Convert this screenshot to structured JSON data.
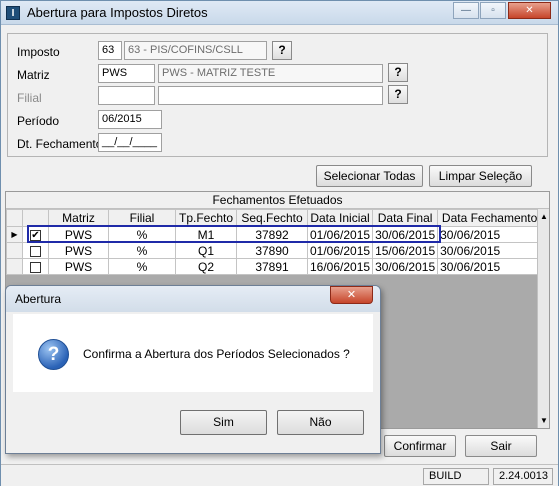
{
  "window": {
    "title": "Abertura para Impostos Diretos",
    "app_icon": "I",
    "minimize_glyph": "—",
    "maximize_glyph": "▫",
    "close_glyph": "✕"
  },
  "form": {
    "imposto_label": "Imposto",
    "imposto_code": "63",
    "imposto_desc": "63 - PIS/COFINS/CSLL",
    "matriz_label": "Matriz",
    "matriz_code": "PWS",
    "matriz_desc": "PWS - MATRIZ TESTE",
    "filial_label": "Filial",
    "filial_code": "",
    "filial_desc": "",
    "periodo_label": "Período",
    "periodo_value": "06/2015",
    "dt_fechamento_label": "Dt. Fechamento",
    "dt_fechamento_value": "__/__/____",
    "lookup_glyph": "?"
  },
  "buttons": {
    "selecionar_todas": "Selecionar Todas",
    "limpar_selecao": "Limpar Seleção",
    "confirmar": "Confirmar",
    "sair": "Sair"
  },
  "grid": {
    "caption": "Fechamentos Efetuados",
    "columns": [
      "Matriz",
      "Filial",
      "Tp.Fechto",
      "Seq.Fechto",
      "Data Inicial",
      "Data Final",
      "Data Fechamento"
    ],
    "rows": [
      {
        "checked": true,
        "matriz": "PWS",
        "filial": "%",
        "tp": "M1",
        "seq": "37892",
        "inicial": "01/06/2015",
        "final": "30/06/2015",
        "fechamento": "30/06/2015"
      },
      {
        "checked": false,
        "matriz": "PWS",
        "filial": "%",
        "tp": "Q1",
        "seq": "37890",
        "inicial": "01/06/2015",
        "final": "15/06/2015",
        "fechamento": "30/06/2015"
      },
      {
        "checked": false,
        "matriz": "PWS",
        "filial": "%",
        "tp": "Q2",
        "seq": "37891",
        "inicial": "16/06/2015",
        "final": "30/06/2015",
        "fechamento": "30/06/2015"
      }
    ],
    "current_row_glyph": "▶",
    "check_glyph": "✔",
    "scroll_up_glyph": "▲",
    "scroll_down_glyph": "▼"
  },
  "status": {
    "build_label": "BUILD",
    "version": "2.24.0013"
  },
  "dialog": {
    "title": "Abertura",
    "icon_glyph": "?",
    "message": "Confirma a Abertura dos Períodos Selecionados ?",
    "yes": "Sim",
    "no": "Não",
    "close_glyph": "✕"
  }
}
